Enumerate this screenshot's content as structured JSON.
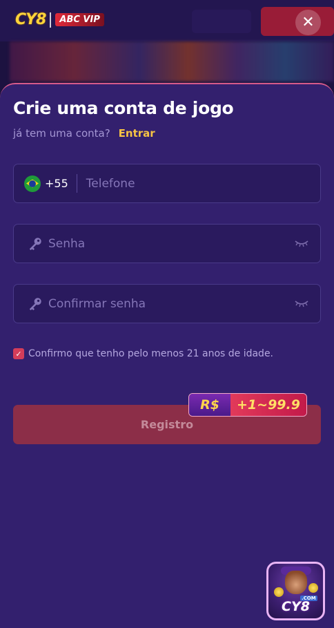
{
  "header": {
    "logo_text": "CY8",
    "partner_logo_text": "ABC VIP",
    "close_icon": "close-icon"
  },
  "form": {
    "title": "Crie uma conta de jogo",
    "subtitle": "já tem uma conta?",
    "login_link": "Entrar",
    "phone": {
      "country_flag": "brazil-flag-icon",
      "country_code": "+55",
      "placeholder": "Telefone"
    },
    "password": {
      "icon": "key-icon",
      "placeholder": "Senha",
      "toggle_icon": "eye-closed-icon"
    },
    "confirm_password": {
      "icon": "key-icon",
      "placeholder": "Confirmar senha",
      "toggle_icon": "eye-closed-icon"
    },
    "age_confirm": {
      "checked": true,
      "label": "Confirmo que tenho pelo menos 21 anos de idade."
    },
    "register_button": "Registro",
    "bonus": {
      "currency": "R$",
      "amount": "+1~99.9"
    }
  },
  "app_icon": {
    "label": "CY8",
    "domain_tag": ".COM"
  },
  "colors": {
    "sheet_bg": "#33206e",
    "field_bg": "#2a1a5e",
    "accent_yellow": "#f6c344",
    "register_button_bg": "#8c2e48",
    "checkbox": "#d43d5a"
  }
}
